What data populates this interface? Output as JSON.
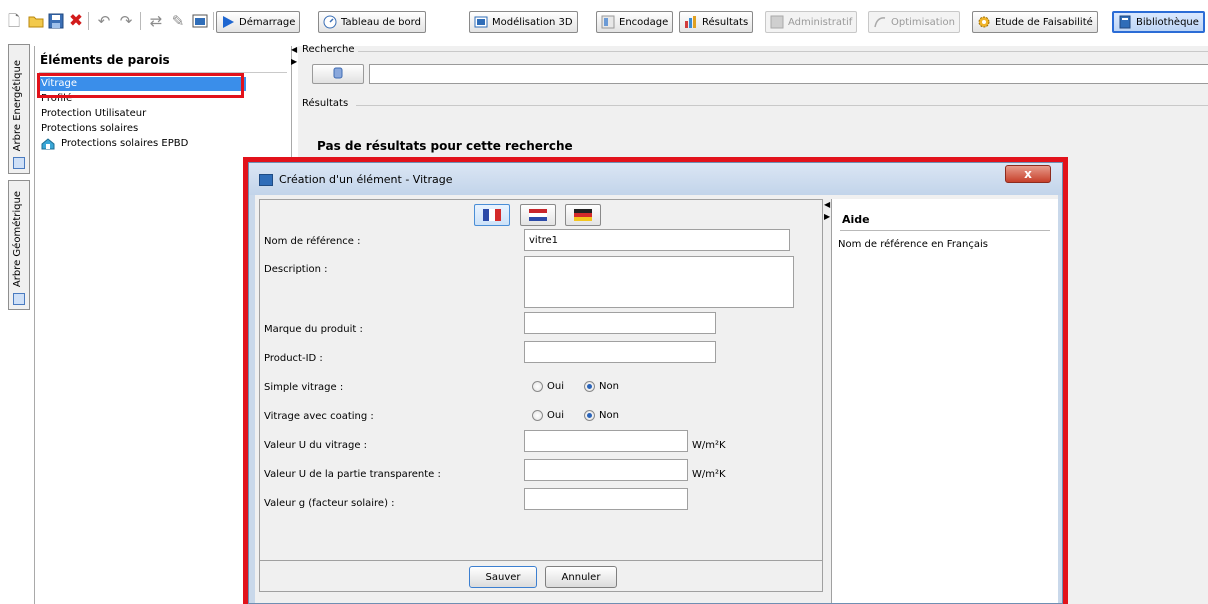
{
  "toolbar": {
    "buttons": [
      {
        "label": "Démarrage"
      },
      {
        "label": "Tableau de bord"
      },
      {
        "label": "Modélisation 3D"
      },
      {
        "label": "Encodage"
      },
      {
        "label": "Résultats"
      },
      {
        "label": "Administratif",
        "disabled": true
      },
      {
        "label": "Optimisation",
        "disabled": true
      },
      {
        "label": "Etude de Faisabilité"
      },
      {
        "label": "Bibliothèque",
        "active": true
      }
    ]
  },
  "side_tabs": {
    "energy": "Arbre Energétique",
    "geometry": "Arbre Géométrique"
  },
  "tree": {
    "title": "Éléments de parois",
    "items": [
      {
        "label": "Vitrage",
        "selected": true
      },
      {
        "label": "Profilé"
      },
      {
        "label": "Protection Utilisateur"
      },
      {
        "label": "Protections solaires"
      },
      {
        "label": "Protections solaires EPBD",
        "icon": "house-icon"
      }
    ]
  },
  "search": {
    "group_label": "Recherche",
    "value": "",
    "results_label": "Résultats",
    "no_results": "Pas de résultats pour cette recherche"
  },
  "dialog": {
    "title": "Création d'un élément - Vitrage",
    "close_label": "x",
    "languages": [
      "fr-flag-icon",
      "nl-flag-icon",
      "de-flag-icon"
    ],
    "fields": {
      "reference_name": {
        "label": "Nom de référence :",
        "value": "vitre1"
      },
      "description": {
        "label": "Description :",
        "value": ""
      },
      "brand": {
        "label": "Marque du produit :",
        "value": ""
      },
      "product_id": {
        "label": "Product-ID :",
        "value": ""
      },
      "single_glazing": {
        "label": "Simple vitrage :",
        "yes": "Oui",
        "no": "Non",
        "selected": "Non"
      },
      "coating": {
        "label": "Vitrage avec coating :",
        "yes": "Oui",
        "no": "Non",
        "selected": "Non"
      },
      "u_glazing": {
        "label": "Valeur U du vitrage :",
        "value": "",
        "unit": "W/m²K"
      },
      "u_transparent": {
        "label": "Valeur U de la partie transparente :",
        "value": "",
        "unit": "W/m²K"
      },
      "g_value": {
        "label": "Valeur g (facteur solaire) :",
        "value": ""
      }
    },
    "save_label": "Sauver",
    "cancel_label": "Annuler",
    "help": {
      "title": "Aide",
      "text": "Nom de référence en Français"
    }
  },
  "colors": {
    "highlight": "#e2121b",
    "selection": "#3a8eea",
    "dialog_frame": "#c9d8ea"
  }
}
